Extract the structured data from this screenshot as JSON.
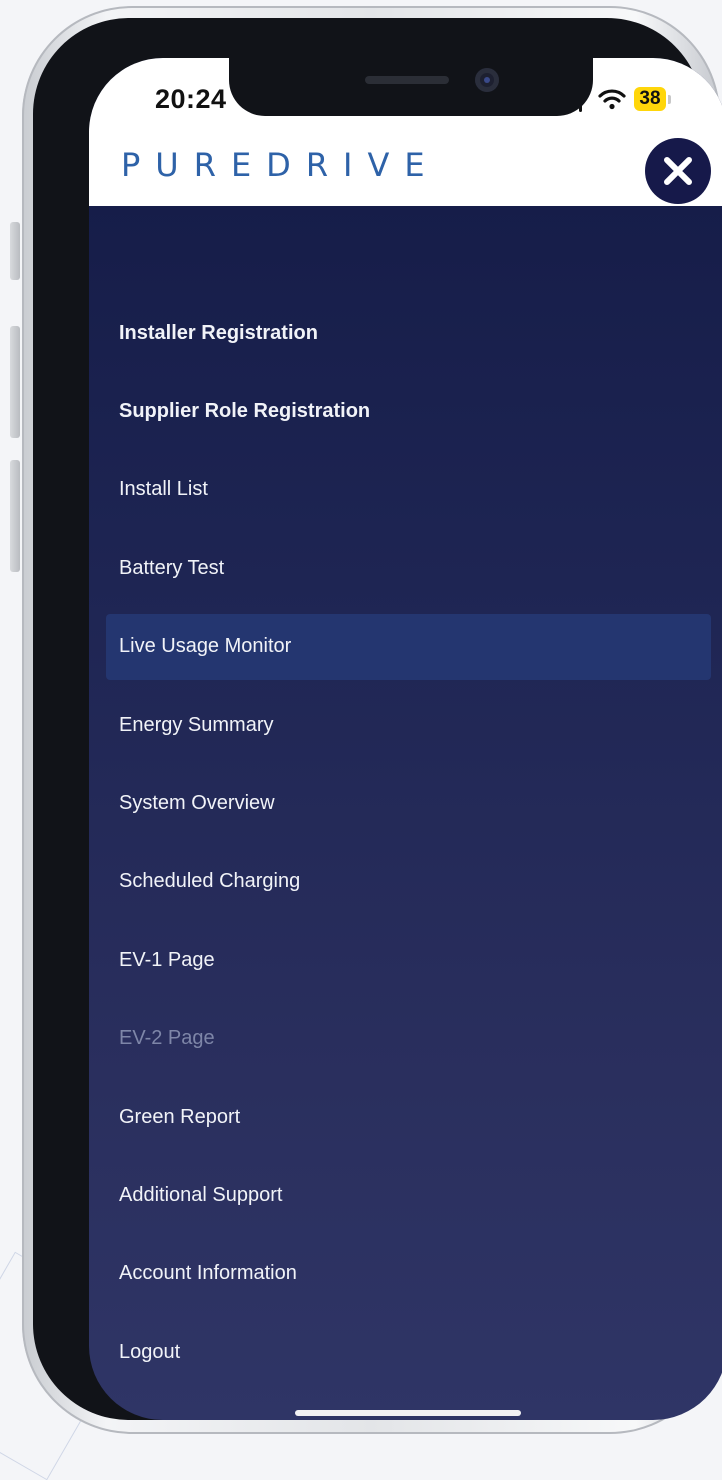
{
  "status_bar": {
    "time": "20:24",
    "battery": "38",
    "wifi_icon": "wifi-icon"
  },
  "header": {
    "logo": "PUREDRIVE",
    "close_icon": "close-icon"
  },
  "colors": {
    "menu_bg_top": "#131a45",
    "menu_bg_bottom": "#2f3566",
    "active_item_bg": "#243670",
    "logo_blue": "#2e62a8",
    "close_button_bg": "#16194a",
    "battery_yellow": "#ffd60a"
  },
  "menu": {
    "items": [
      {
        "label": "Installer Registration"
      },
      {
        "label": "Supplier Role Registration"
      },
      {
        "label": "Install List"
      },
      {
        "label": "Battery Test"
      },
      {
        "label": "Live Usage Monitor"
      },
      {
        "label": "Energy Summary"
      },
      {
        "label": "System Overview"
      },
      {
        "label": "Scheduled Charging"
      },
      {
        "label": "EV-1 Page"
      },
      {
        "label": "EV-2 Page"
      },
      {
        "label": "Green Report"
      },
      {
        "label": "Additional Support"
      },
      {
        "label": "Account Information"
      },
      {
        "label": "Logout"
      }
    ]
  }
}
